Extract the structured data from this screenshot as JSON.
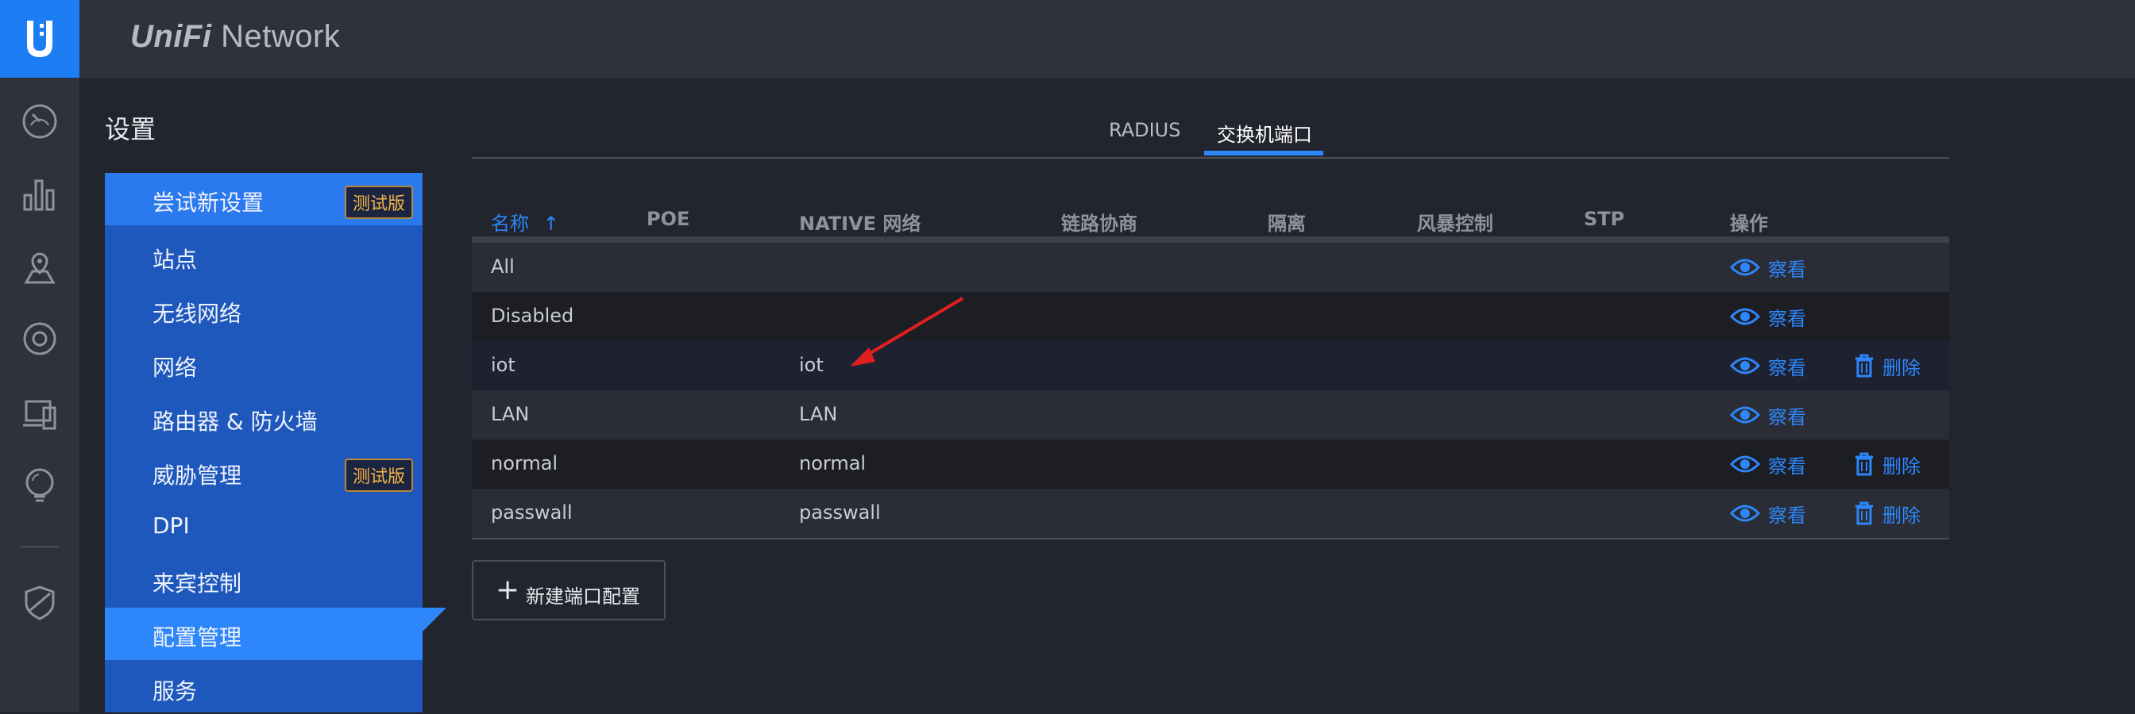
{
  "app": {
    "brand_prefix": "UniFi",
    "brand_suffix": " Network"
  },
  "settings": {
    "title": "设置"
  },
  "nav": {
    "items": [
      {
        "label": "尝试新设置",
        "badge": "测试版"
      },
      {
        "label": "站点"
      },
      {
        "label": "无线网络"
      },
      {
        "label": "网络"
      },
      {
        "label": "路由器 & 防火墙"
      },
      {
        "label": "威胁管理",
        "badge": "测试版"
      },
      {
        "label": "DPI"
      },
      {
        "label": "来宾控制"
      },
      {
        "label": "配置管理",
        "active": true
      },
      {
        "label": "服务"
      }
    ]
  },
  "tabs": [
    {
      "label": "RADIUS"
    },
    {
      "label": "交换机端口",
      "active": true
    }
  ],
  "table": {
    "columns": [
      "名称",
      "POE",
      "NATIVE 网络",
      "链路协商",
      "隔离",
      "风暴控制",
      "STP",
      "操作"
    ],
    "sort_indicator": "↑",
    "rows": [
      {
        "name": "All",
        "native": ""
      },
      {
        "name": "Disabled",
        "native": ""
      },
      {
        "name": "iot",
        "native": "iot"
      },
      {
        "name": "LAN",
        "native": "LAN"
      },
      {
        "name": "normal",
        "native": "normal"
      },
      {
        "name": "passwall",
        "native": "passwall"
      }
    ],
    "view_label": "察看",
    "delete_label": "删除"
  },
  "actions": {
    "new_profile": "新建端口配置"
  },
  "colors": {
    "accent": "#2e86fb",
    "nav_bg": "#1f58bd",
    "beta": "#f6b543",
    "annotation": "#e02020"
  }
}
